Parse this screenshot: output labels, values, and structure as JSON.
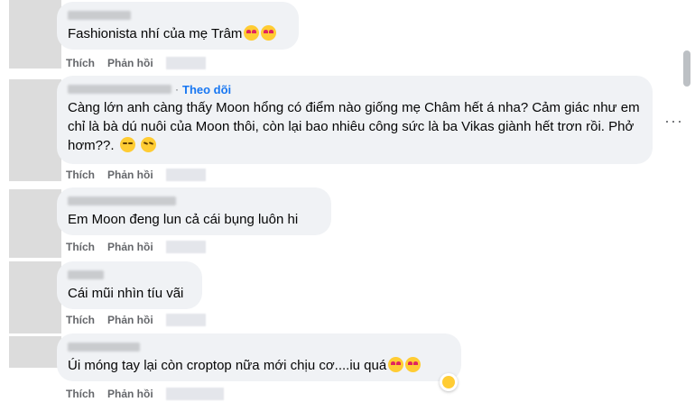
{
  "comments": [
    {
      "text": "Fashionista nhí của mẹ Trâm",
      "follow": "",
      "emojis": [
        "heart-eyes-icon",
        "heart-eyes-icon"
      ]
    },
    {
      "text": "Càng lớn anh càng thấy Moon hổng có điểm nào giống mẹ Châm hết á nha? Cảm giác như em chỉ là bà dú nuôi của Moon thôi, còn lại bao nhiêu công sức là ba Vikas giành hết trơn rồi. Phở hơm??.",
      "follow": "Theo dõi",
      "emojis": [
        "grin-icon",
        "laugh-icon"
      ]
    },
    {
      "text": "Em Moon đeng lun cả cái bụng luôn hi",
      "follow": "",
      "emojis": []
    },
    {
      "text": "Cái mũi nhìn tíu vãi",
      "follow": "",
      "emojis": []
    },
    {
      "text": "Úi móng tay lại còn croptop nữa mới chịu cơ....iu quá",
      "follow": "",
      "emojis": [
        "heart-eyes-icon",
        "heart-eyes-icon"
      ]
    }
  ],
  "actions": {
    "like": "Thích",
    "reply": "Phản hồi"
  },
  "more_label": "···"
}
